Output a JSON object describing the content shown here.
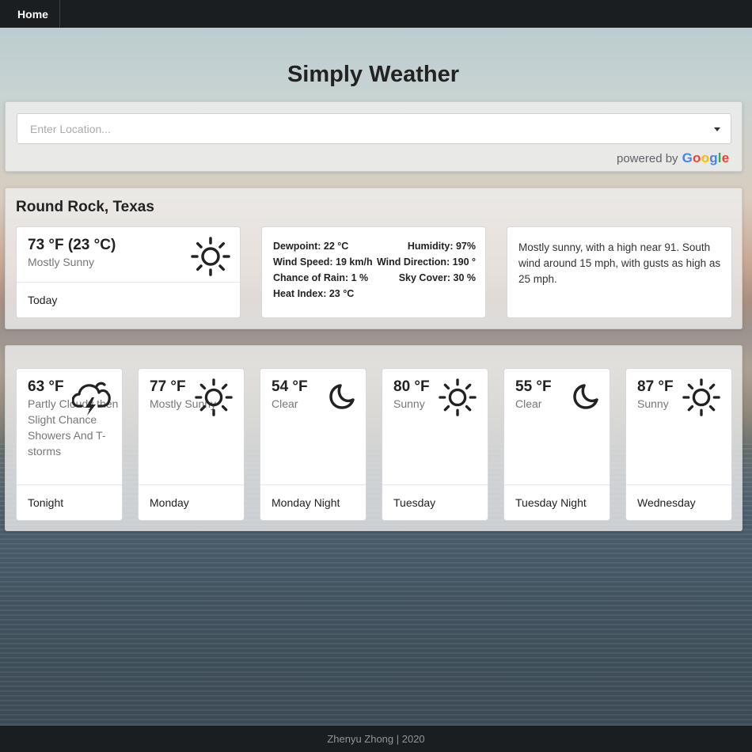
{
  "nav": {
    "home_label": "Home"
  },
  "page_title": "Simply Weather",
  "search": {
    "placeholder": "Enter Location...",
    "powered_by": "powered by",
    "google_letters": [
      "G",
      "o",
      "o",
      "g",
      "l",
      "e"
    ]
  },
  "location": "Round Rock, Texas",
  "today": {
    "temp": "73 °F (23 °C)",
    "condition": "Mostly Sunny",
    "icon": "sun-icon",
    "label": "Today"
  },
  "details": {
    "dewpoint": "Dewpoint: 22 °C",
    "humidity": "Humidity: 97%",
    "wind_speed": "Wind Speed: 19 km/h",
    "wind_direction": "Wind Direction: 190 °",
    "chance_of_rain": "Chance of Rain: 1 %",
    "sky_cover": "Sky Cover: 30 %",
    "heat_index": "Heat Index: 23 °C"
  },
  "forecast_text": "Mostly sunny, with a high near 91. South wind around 15 mph, with gusts as high as 25 mph.",
  "days": [
    {
      "temp": "63 °F",
      "condition": "Partly Cloudy then Slight Chance Showers And T-storms",
      "icon": "thunderstorm-icon",
      "label": "Tonight"
    },
    {
      "temp": "77 °F",
      "condition": "Mostly Sunny",
      "icon": "sun-icon",
      "label": "Monday"
    },
    {
      "temp": "54 °F",
      "condition": "Clear",
      "icon": "moon-icon",
      "label": "Monday Night"
    },
    {
      "temp": "80 °F",
      "condition": "Sunny",
      "icon": "sun-icon",
      "label": "Tuesday"
    },
    {
      "temp": "55 °F",
      "condition": "Clear",
      "icon": "moon-icon",
      "label": "Tuesday Night"
    },
    {
      "temp": "87 °F",
      "condition": "Sunny",
      "icon": "sun-icon",
      "label": "Wednesday"
    }
  ],
  "footer": "Zhenyu Zhong | 2020"
}
